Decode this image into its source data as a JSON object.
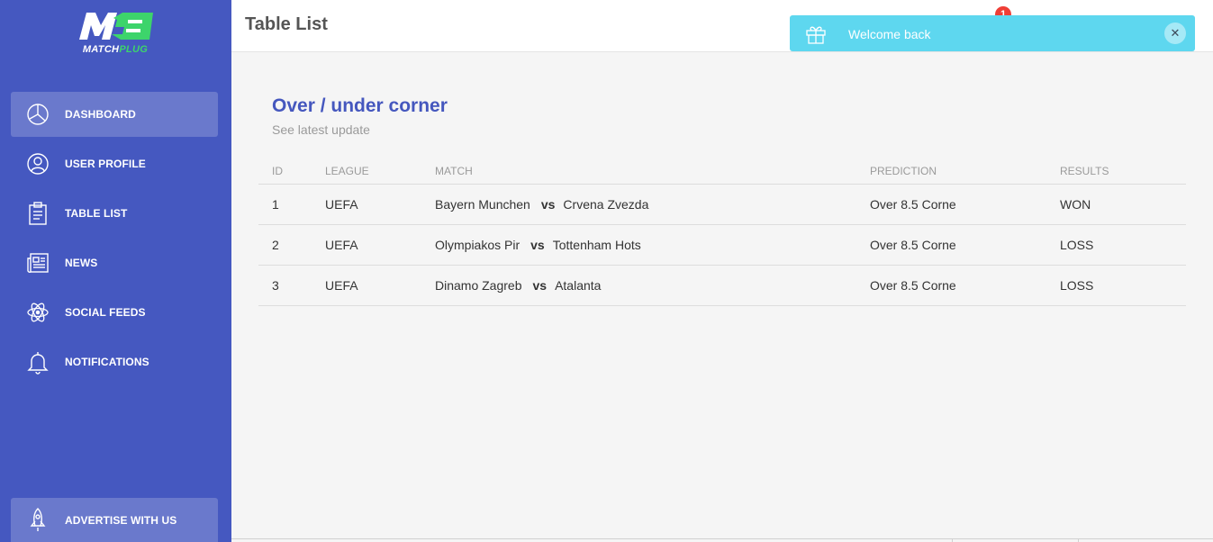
{
  "brand": {
    "name_main": "MATCH",
    "name_accent": "PLUG",
    "accent_color": "#3dd46b",
    "sidebar_color": "#4558c0"
  },
  "sidebar": {
    "items": [
      {
        "label": "DASHBOARD",
        "icon": "pie-chart-icon",
        "active": true
      },
      {
        "label": "USER PROFILE",
        "icon": "user-icon",
        "active": false
      },
      {
        "label": "TABLE LIST",
        "icon": "clipboard-icon",
        "active": false
      },
      {
        "label": "NEWS",
        "icon": "newspaper-icon",
        "active": false
      },
      {
        "label": "SOCIAL FEEDS",
        "icon": "atom-icon",
        "active": false
      },
      {
        "label": "NOTIFICATIONS",
        "icon": "bell-icon",
        "active": false
      }
    ],
    "advertise": {
      "label": "ADVERTISE WITH US",
      "icon": "rocket-icon"
    }
  },
  "header": {
    "title": "Table List",
    "notification_count": "1"
  },
  "toast": {
    "message": "Welcome back",
    "icon": "gift-icon",
    "close_glyph": "✕",
    "color": "#5ed7ef"
  },
  "card": {
    "title": "Over / under corner",
    "subtitle": "See latest update",
    "columns": [
      "ID",
      "LEAGUE",
      "MATCH",
      "PREDICTION",
      "RESULTS"
    ],
    "vs_label": "vs",
    "rows": [
      {
        "id": "1",
        "league": "UEFA",
        "home": "Bayern Munchen",
        "away": "Crvena Zvezda",
        "prediction": "Over 8.5 Corne",
        "result": "WON"
      },
      {
        "id": "2",
        "league": "UEFA",
        "home": "Olympiakos Pir",
        "away": "Tottenham Hots",
        "prediction": "Over 8.5 Corne",
        "result": "LOSS"
      },
      {
        "id": "3",
        "league": "UEFA",
        "home": "Dinamo Zagreb",
        "away": "Atalanta",
        "prediction": "Over 8.5 Corne",
        "result": "LOSS"
      }
    ]
  }
}
